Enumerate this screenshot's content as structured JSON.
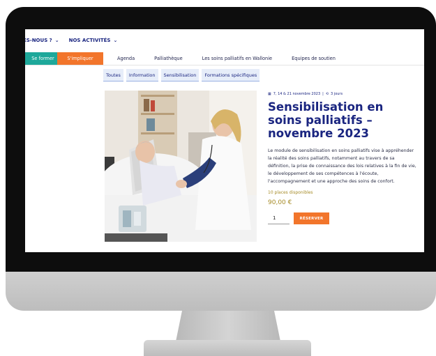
{
  "topnav": {
    "items": [
      {
        "label": "MES-NOUS ?"
      },
      {
        "label": "NOS ACTIVITÉS"
      }
    ]
  },
  "menubar": {
    "items": [
      {
        "label": "Se former"
      },
      {
        "label": "S'impliquer"
      },
      {
        "label": "Agenda"
      },
      {
        "label": "Palliathèque"
      },
      {
        "label": "Les soins palliatifs en Wallonie"
      },
      {
        "label": "Equipes de soutien"
      }
    ]
  },
  "filters": [
    "Toutes",
    "Information",
    "Sensibilisation",
    "Formations spécifiques"
  ],
  "event": {
    "dates": "7, 14 & 21 novembre 2023",
    "duration": "3 jours",
    "title": "Sensibilisation en soins palliatifs – novembre 2023",
    "description": "Le module de sensibilisation en soins palliatifs vise à appréhender la réalité des soins palliatifs, notamment au travers de sa définition, la prise de connaissance des lois relatives à la fin de vie, le développement de ses compétences à l'écoute, l'accompagnement et une approche des soins de confort.",
    "places": "10 places disponibles",
    "price": "90,00 €",
    "quantity": "1",
    "reserve_label": "RÉSERVER"
  },
  "colors": {
    "navy": "#1a2580",
    "teal": "#1ea89a",
    "orange": "#f2752b",
    "gold": "#a68b27"
  }
}
